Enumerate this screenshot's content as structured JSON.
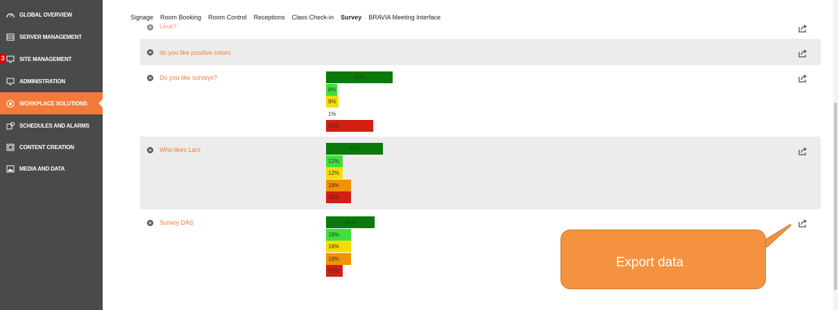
{
  "sidebar": {
    "items": [
      {
        "label": "GLOBAL OVERVIEW",
        "icon": "dashboard-icon"
      },
      {
        "label": "SERVER MANAGEMENT",
        "icon": "server-icon"
      },
      {
        "label": "SITE MANAGEMENT",
        "icon": "monitor-icon",
        "badge": "3"
      },
      {
        "label": "ADMINISTRATION",
        "icon": "monitor-icon"
      },
      {
        "label": "WORKPLACE SOLUTIONS",
        "icon": "grid-circle-icon",
        "active": true
      },
      {
        "label": "SCHEDULES AND ALARMS",
        "icon": "schedule-icon"
      },
      {
        "label": "CONTENT CREATION",
        "icon": "content-icon"
      },
      {
        "label": "MEDIA AND DATA",
        "icon": "image-icon"
      }
    ]
  },
  "tabs": [
    "Signage",
    "Room Booking",
    "Room Control",
    "Receptions",
    "Class Check-in",
    "Survey",
    "BRAVIA Meeting Interface"
  ],
  "active_tab": "Survey",
  "colors": {
    "accent": "#f47a3a",
    "sidebar": "#4a4a4a",
    "callout": "#f4923f"
  },
  "questions": [
    {
      "text": "Leuk?",
      "bars": []
    },
    {
      "text": "do you like positive colors",
      "bars": []
    },
    {
      "text": "Do you like surveys?",
      "bars": [
        {
          "label": "48%",
          "value": 48
        },
        {
          "label": "8%",
          "value": 8
        },
        {
          "label": "9%",
          "value": 9
        },
        {
          "label": "1%",
          "value": 1
        },
        {
          "label": "34%",
          "value": 34
        }
      ]
    },
    {
      "text": "Who likes Lars",
      "bars": [
        {
          "label": "41%",
          "value": 41
        },
        {
          "label": "12%",
          "value": 12
        },
        {
          "label": "12%",
          "value": 12
        },
        {
          "label": "18%",
          "value": 18
        },
        {
          "label": "18%",
          "value": 18
        }
      ]
    },
    {
      "text": "Survey DAS",
      "bars": [
        {
          "label": "35%",
          "value": 35
        },
        {
          "label": "18%",
          "value": 18
        },
        {
          "label": "18%",
          "value": 18
        },
        {
          "label": "18%",
          "value": 18
        },
        {
          "label": "12%",
          "value": 12
        }
      ]
    }
  ],
  "callout": {
    "text": "Export data"
  }
}
